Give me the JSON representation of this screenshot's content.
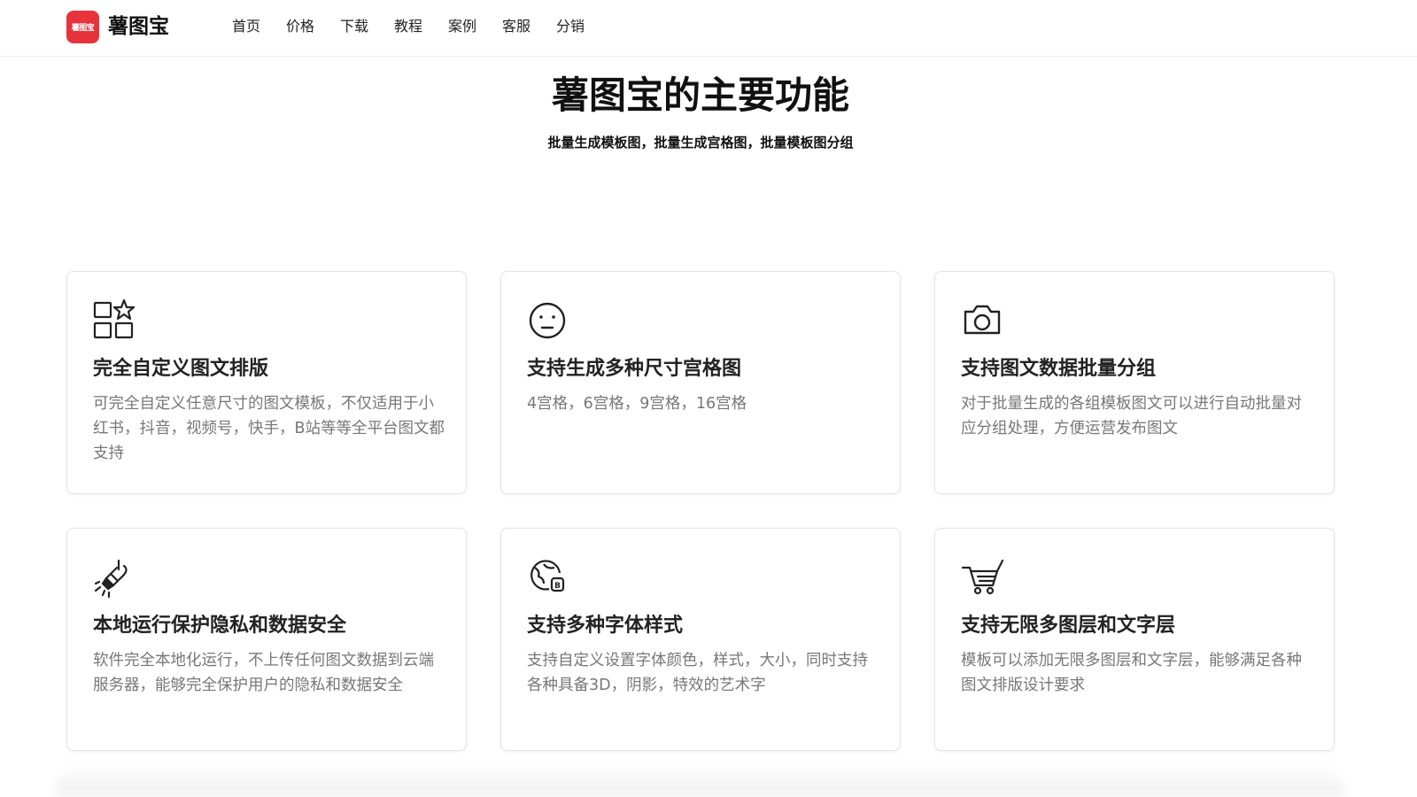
{
  "header": {
    "logo_icon_text": "薯图宝",
    "logo_text": "薯图宝",
    "brand_color": "#e8323c",
    "nav": [
      "首页",
      "价格",
      "下载",
      "教程",
      "案例",
      "客服",
      "分销"
    ]
  },
  "hero": {
    "title": "薯图宝的主要功能",
    "subtitle": "批量生成模板图，批量生成宫格图，批量模板图分组"
  },
  "features": [
    {
      "icon": "grid-star-icon",
      "title": "完全自定义图文排版",
      "desc": "可完全自定义任意尺寸的图文模板，不仅适用于小红书，抖音，视频号，快手，B站等等全平台图文都支持"
    },
    {
      "icon": "face-icon",
      "title": "支持生成多种尺寸宫格图",
      "desc": "4宫格，6宫格，9宫格，16宫格"
    },
    {
      "icon": "camera-icon",
      "title": "支持图文数据批量分组",
      "desc": "对于批量生成的各组模板图文可以进行自动批量对应分组处理，方便运营发布图文"
    },
    {
      "icon": "flashlight-icon",
      "title": "本地运行保护隐私和数据安全",
      "desc": "软件完全本地化运行，不上传任何图文数据到云端服务器，能够完全保护用户的隐私和数据安全"
    },
    {
      "icon": "globe-badge-icon",
      "title": "支持多种字体样式",
      "desc": "支持自定义设置字体颜色，样式，大小，同时支持各种具备3D，阴影，特效的艺术字"
    },
    {
      "icon": "cart-icon",
      "title": "支持无限多图层和文字层",
      "desc": "模板可以添加无限多图层和文字层，能够满足各种图文排版设计要求"
    }
  ]
}
